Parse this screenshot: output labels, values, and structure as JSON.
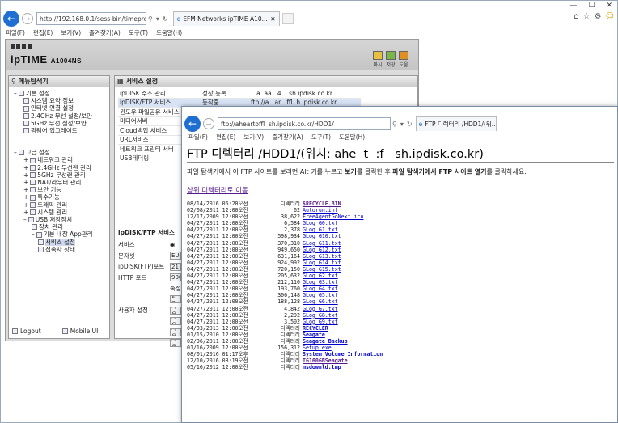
{
  "browser1": {
    "address": "http://192.168.0.1/sess-bin/timepro.c",
    "tab_title": "EFM Networks ipTIME A10...",
    "menu": [
      "파일(F)",
      "편집(E)",
      "보기(V)",
      "즐겨찾기(A)",
      "도구(T)",
      "도움말(H)"
    ],
    "controls": [
      "—",
      "☐",
      "✕"
    ]
  },
  "iptime": {
    "logo": "ipTIME",
    "model": "A1004NS",
    "header_icons": [
      "마시",
      "저장",
      "도움"
    ],
    "left_title": "메뉴탐색기",
    "tree": {
      "basic": "기본 설정",
      "basic_items": [
        "시스템 요약 정보",
        "인터넷 연결 설정",
        "2.4GHz 무선 설정/보안",
        "5GHz 무선 설정/보안",
        "펌웨어 업그레이드"
      ],
      "advanced": "고급 설정",
      "advanced_items": [
        "네트워크 관리",
        "2.4GHz 무선랜 관리",
        "5GHz 무선랜 관리",
        "NAT/라우터 관리",
        "보안 기능",
        "특수기능",
        "트래픽 관리",
        "시스템 관리",
        "USB 저장장치"
      ],
      "usb_items": [
        "장치 관리",
        "기본 내장 App관리"
      ],
      "app_items": [
        "서비스 설정",
        "접속자 상태"
      ]
    },
    "logout": "Logout",
    "mobile": "Mobile UI",
    "main_title": "서비스 설정",
    "services": [
      {
        "name": "ipDISK 주소 관리",
        "status": "정상 등록",
        "url": "   a. aa  .4    sh.ipdisk.co.kr"
      },
      {
        "name": "ipDISK/FTP 서비스",
        "status": "동작중",
        "url": "ftp://a   ar   ffl  h.ipdisk.co.kr"
      },
      {
        "name": "윈도우 파일공유 서비스",
        "status": "",
        "url": ""
      },
      {
        "name": "미디어서버",
        "status": "",
        "url": ""
      },
      {
        "name": "Cloud백업 서비스",
        "status": "",
        "url": ""
      },
      {
        "name": "URL서비스",
        "status": "",
        "url": ""
      },
      {
        "name": "네트워크 프린터 서버",
        "status": "",
        "url": ""
      },
      {
        "name": "USB테더링",
        "status": "",
        "url": ""
      }
    ],
    "form_title": "ipDISK/FTP 서비스",
    "form_rows": [
      {
        "label": "서비스",
        "value": "◉"
      },
      {
        "label": "문자셋",
        "value": "EUC"
      },
      {
        "label": "ipDISK(FTP)포트",
        "value": "21"
      },
      {
        "label": "HTTP 포트",
        "value": "900"
      },
      {
        "label": "",
        "value": "속성"
      },
      {
        "label": "",
        "value": "읽기"
      },
      {
        "label": "사용자 설정",
        "value": "사용"
      },
      {
        "label": "",
        "value": "사용"
      },
      {
        "label": "",
        "value": "사용"
      },
      {
        "label": "",
        "value": "사용"
      }
    ]
  },
  "ftp": {
    "address": "ftp://aheartoffl  sh.ipdisk.co.kr/HDD1/",
    "tab_title": "FTP 디렉터리 /HDD1/(위...",
    "menu": [
      "파일(F)",
      "편집(E)",
      "보기(V)",
      "즐겨찾기(A)",
      "도구(T)",
      "도움말(H)"
    ],
    "heading": "FTP 디렉터리 /HDD1/(위치: ahe  t  :f   sh.ipdisk.co.kr)",
    "desc_pre": "파일 탐색기에서 이 FTP 사이트를 보려면 Alt 키를 누르고 ",
    "desc_b1": "보기",
    "desc_mid": "를 클릭한 후 ",
    "desc_b2": "파일 탐색기에서 FTP 사이트 열기",
    "desc_post": "를 클릭하세요.",
    "up_link": "상위 디렉터리로 이동",
    "entries": [
      {
        "date": "08/14/2016 06:20오전",
        "size": "디렉터리",
        "name": "$RECYCLE.BIN",
        "dir": true,
        "visited": true
      },
      {
        "date": "02/08/2011 12:00오전",
        "size": "62",
        "name": "Autorun.inf",
        "dir": false,
        "visited": false
      },
      {
        "date": "12/17/2009 12:00오전",
        "size": "38,622",
        "name": "FreeAgentGoNext.ico",
        "dir": false,
        "visited": false
      },
      {
        "date": "04/27/2011 12:00오전",
        "size": "6,584",
        "name": "GLog_G0.txt",
        "dir": false,
        "visited": false
      },
      {
        "date": "04/27/2011 12:00오전",
        "size": "2,378",
        "name": "GLog_G1.txt",
        "dir": false,
        "visited": false
      },
      {
        "date": "04/27/2011 12:00오전",
        "size": "598,934",
        "name": "GLog_G10.txt",
        "dir": false,
        "visited": false
      },
      {
        "date": "04/27/2011 12:00오전",
        "size": "370,310",
        "name": "GLog_G11.txt",
        "dir": false,
        "visited": false
      },
      {
        "date": "04/27/2011 12:00오전",
        "size": "949,650",
        "name": "GLog_G12.txt",
        "dir": false,
        "visited": false
      },
      {
        "date": "04/27/2011 12:00오전",
        "size": "631,164",
        "name": "GLog_G13.txt",
        "dir": false,
        "visited": false
      },
      {
        "date": "04/27/2011 12:00오전",
        "size": "924,992",
        "name": "GLog_G14.txt",
        "dir": false,
        "visited": false
      },
      {
        "date": "04/27/2011 12:00오전",
        "size": "720,150",
        "name": "GLog_G15.txt",
        "dir": false,
        "visited": false
      },
      {
        "date": "04/27/2011 12:00오전",
        "size": "205,632",
        "name": "GLog_G2.txt",
        "dir": false,
        "visited": false
      },
      {
        "date": "04/27/2011 12:00오전",
        "size": "212,110",
        "name": "GLog_G3.txt",
        "dir": false,
        "visited": false
      },
      {
        "date": "04/27/2011 12:00오전",
        "size": "193,760",
        "name": "GLog_G4.txt",
        "dir": false,
        "visited": false
      },
      {
        "date": "04/27/2011 12:00오전",
        "size": "306,148",
        "name": "GLog_G5.txt",
        "dir": false,
        "visited": false
      },
      {
        "date": "04/27/2011 12:00오전",
        "size": "188,128",
        "name": "GLog_G6.txt",
        "dir": false,
        "visited": false
      },
      {
        "date": "04/27/2011 12:00오전",
        "size": "4,842",
        "name": "GLog_G7.txt",
        "dir": false,
        "visited": false
      },
      {
        "date": "04/27/2011 12:00오전",
        "size": "2,292",
        "name": "GLog_G8.txt",
        "dir": false,
        "visited": false
      },
      {
        "date": "04/27/2011 12:00오전",
        "size": "3,502",
        "name": "GLog_G9.txt",
        "dir": false,
        "visited": false
      },
      {
        "date": "04/03/2013 12:00오전",
        "size": "디렉터리",
        "name": "RECYCLER",
        "dir": true,
        "visited": false
      },
      {
        "date": "01/15/2010 12:00오전",
        "size": "디렉터리",
        "name": "Seagate",
        "dir": true,
        "visited": false
      },
      {
        "date": "02/06/2011 12:00오전",
        "size": "디렉터리",
        "name": "Seagate Backup",
        "dir": true,
        "visited": false
      },
      {
        "date": "01/16/2009 12:00오전",
        "size": "156,312",
        "name": "Setup.exe",
        "dir": false,
        "visited": false
      },
      {
        "date": "08/01/2016 01:17오후",
        "size": "디렉터리",
        "name": "System Volume Information",
        "dir": true,
        "visited": false
      },
      {
        "date": "12/10/2016 08:19오전",
        "size": "디렉터리",
        "name": "TG160GBSeagate",
        "dir": true,
        "visited": true
      },
      {
        "date": "05/16/2012 12:00오전",
        "size": "디렉터리",
        "name": "msdownld.tmp",
        "dir": true,
        "visited": false
      }
    ]
  }
}
